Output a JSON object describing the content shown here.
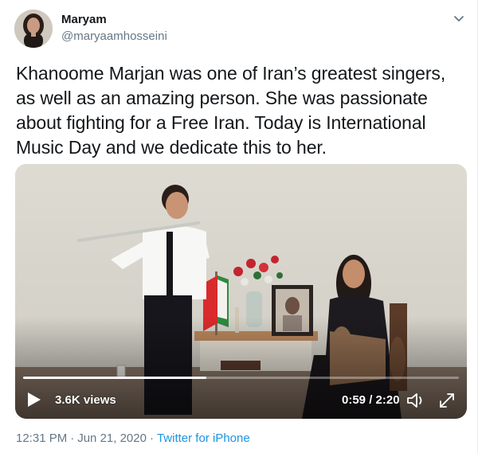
{
  "author": {
    "name": "Maryam",
    "handle": "@maryaamhosseini"
  },
  "tweet": {
    "text": "Khanoome Marjan was one of Iran’s greatest singers, as well as an amazing person. She was passionate  about fighting for a Free Iran. Today is International Music Day and we dedicate this to her."
  },
  "video": {
    "views": "3.6K views",
    "time": "0:59 / 2:20",
    "progress_fraction": 0.42
  },
  "meta": {
    "time": "12:31 PM",
    "separator": "·",
    "date": "Jun 21, 2020",
    "source": "Twitter for iPhone"
  },
  "icons": {
    "more": "chevron-down-icon",
    "play": "play-icon",
    "volume": "volume-icon",
    "fullscreen": "fullscreen-icon"
  },
  "colors": {
    "link": "#1b95e0",
    "secondary_text": "#657786",
    "primary_text": "#14171a"
  }
}
